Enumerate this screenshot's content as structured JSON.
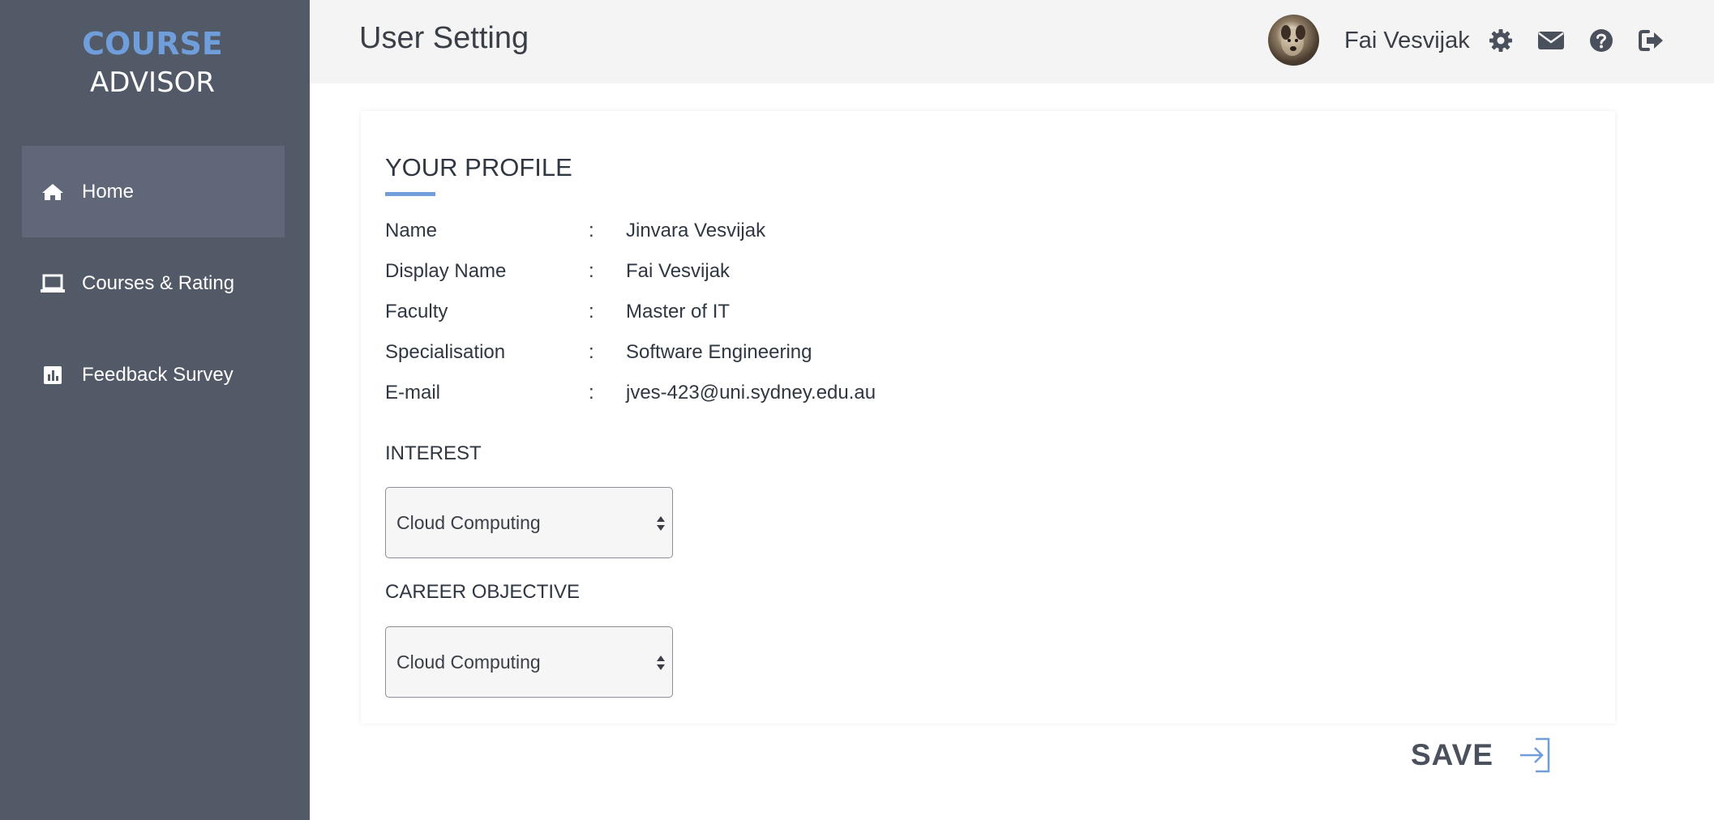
{
  "app": {
    "logo_line1": "COURSE",
    "logo_line2": "ADVISOR"
  },
  "sidebar": {
    "items": [
      {
        "label": "Home",
        "icon": "home-icon",
        "active": true
      },
      {
        "label": "Courses & Rating",
        "icon": "laptop-icon",
        "active": false
      },
      {
        "label": "Feedback Survey",
        "icon": "bar-chart-icon",
        "active": false
      }
    ]
  },
  "header": {
    "title": "User Setting",
    "user_name": "Fai Vesvijak",
    "icons": [
      "gear-icon",
      "envelope-icon",
      "help-icon",
      "logout-icon"
    ]
  },
  "profile": {
    "section_title": "YOUR PROFILE",
    "rows": [
      {
        "label": "Name",
        "colon": ":",
        "value": "Jinvara Vesvijak"
      },
      {
        "label": "Display Name",
        "colon": ":",
        "value": "Fai Vesvijak"
      },
      {
        "label": "Faculty",
        "colon": ":",
        "value": "Master of IT"
      },
      {
        "label": "Specialisation",
        "colon": ":",
        "value": "Software Engineering"
      },
      {
        "label": "E-mail",
        "colon": ":",
        "value": "jves-423@uni.sydney.edu.au"
      }
    ],
    "interest_label": "INTEREST",
    "interest_value": "Cloud Computing",
    "career_label": "CAREER OBJECTIVE",
    "career_value": "Cloud Computing"
  },
  "actions": {
    "save_label": "SAVE"
  },
  "colors": {
    "accent": "#6f9edb",
    "sidebar_bg": "#525967",
    "sidebar_active": "#5f6778",
    "topbar_bg": "#f4f4f4"
  }
}
